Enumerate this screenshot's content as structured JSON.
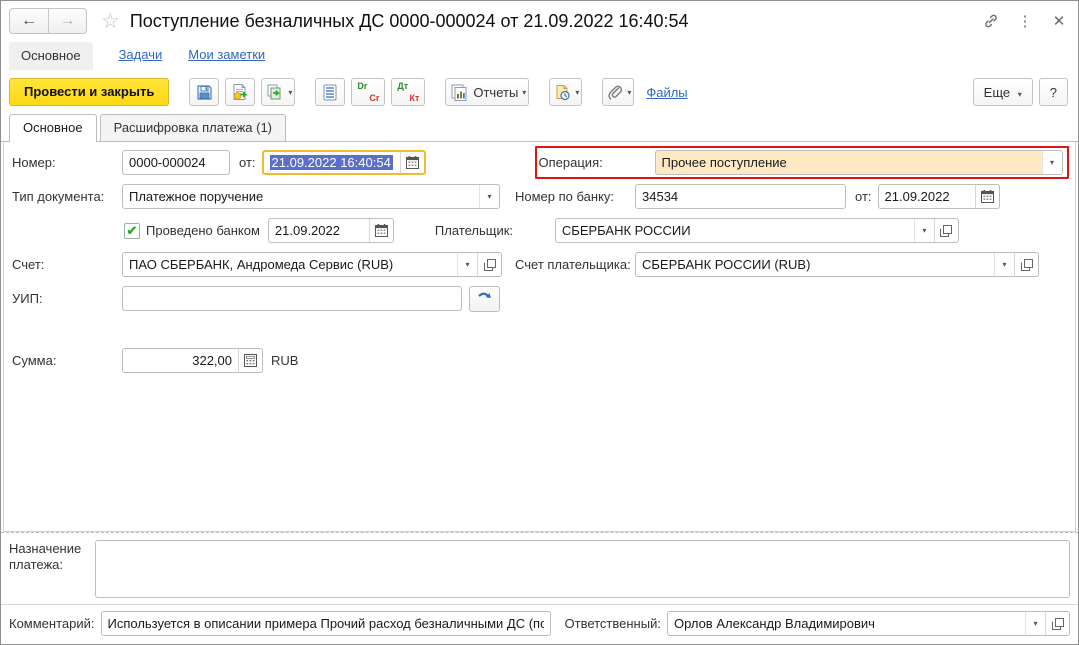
{
  "window": {
    "title": "Поступление безналичных ДС 0000-000024 от 21.09.2022 16:40:54"
  },
  "icons": {
    "back": "←",
    "forward": "→",
    "star": "☆",
    "kebab": "⋮",
    "close": "✕",
    "dropdown": "▾",
    "check": "✔",
    "help": "?"
  },
  "nav": {
    "current": "Основное",
    "tasks": "Задачи",
    "notes": "Мои заметки"
  },
  "toolbar": {
    "post_and_close": "Провести и закрыть",
    "drcr_dr": "Dr",
    "drcr_cr": "Cr",
    "dtkt_dt": "Дт",
    "dtkt_kt": "Кт",
    "reports": "Отчеты",
    "files_link": "Файлы",
    "more": "Еще"
  },
  "tabs": {
    "main": "Основное",
    "breakdown": "Расшифровка платежа (1)"
  },
  "form": {
    "number": {
      "label": "Номер:",
      "value": "0000-000024"
    },
    "date": {
      "label": "от:",
      "value": "21.09.2022 16:40:54"
    },
    "operation": {
      "label": "Операция:",
      "value": "Прочее поступление"
    },
    "doc_type": {
      "label": "Тип документа:",
      "value": "Платежное поручение"
    },
    "bank_number": {
      "label": "Номер по банку:",
      "value": "34534"
    },
    "bank_date": {
      "label": "от:",
      "value": "21.09.2022"
    },
    "posted_by_bank": {
      "label": "Проведено банком",
      "checked": true,
      "date": "21.09.2022"
    },
    "payer": {
      "label": "Плательщик:",
      "value": "СБЕРБАНК РОССИИ"
    },
    "account": {
      "label": "Счет:",
      "value": "ПАО СБЕРБАНК, Андромеда Сервис (RUB)"
    },
    "payer_account": {
      "label": "Счет плательщика:",
      "value": "СБЕРБАНК РОССИИ (RUB)"
    },
    "uip": {
      "label": "УИП:",
      "value": ""
    },
    "amount": {
      "label": "Сумма:",
      "value": "322,00",
      "currency": "RUB"
    },
    "purpose": {
      "label": "Назначение платежа:",
      "value": ""
    },
    "comment": {
      "label": "Комментарий:",
      "value": "Используется в описании примера Прочий расход безналичными ДС (по"
    },
    "responsible": {
      "label": "Ответственный:",
      "value": "Орлов Александр Владимирович"
    }
  },
  "colors": {
    "primary_button": "#ffdd2d",
    "operation_highlight": "#ffe9c4",
    "annotation_red": "#e11414",
    "selection_blue": "#5a6fc8",
    "focus_border": "#efbb2f",
    "link_blue": "#3166c5"
  }
}
